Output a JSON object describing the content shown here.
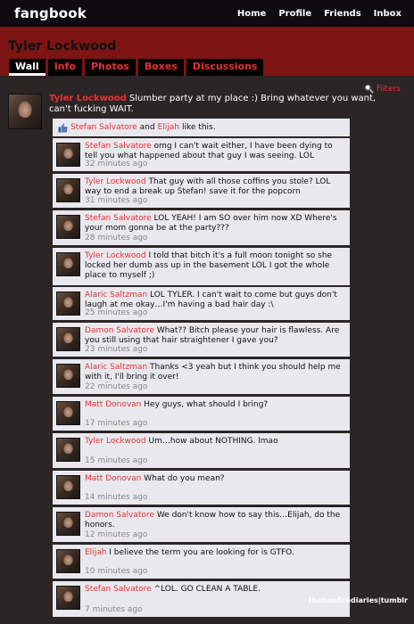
{
  "app": {
    "logo": "fangbook"
  },
  "nav": [
    "Home",
    "Profile",
    "Friends",
    "Inbox"
  ],
  "profile": {
    "name": "Tyler Lockwood"
  },
  "tabs": [
    "Wall",
    "Info",
    "Photos",
    "Boxes",
    "Discussions"
  ],
  "filters": "Filters",
  "post": {
    "author": "Tyler Lockwood",
    "text": "Slumber party at my place :) Bring whatever you want, can't fucking WAIT."
  },
  "likes": {
    "user1": "Stefan Salvatore",
    "and": "and",
    "user2": "Elijah",
    "suffix": "like this."
  },
  "comments": [
    {
      "author": "Stefan Salvatore",
      "text": "omg I can't wait either, I have been dying to tell you what happened about that guy I was seeing. LOL",
      "time": "32 minutes ago"
    },
    {
      "author": "Tyler Lockwood",
      "text": "That guy with all those coffins you stole? LOL way to end a break up Stefan! save it for the popcorn",
      "time": "31 minutes ago"
    },
    {
      "author": "Stefan Salvatore",
      "text": "LOL YEAH! I am SO over him now XD Where's your mom gonna be at the party???",
      "time": "28 minutes ago"
    },
    {
      "author": "Tyler Lockwood",
      "text": "I told that bitch it's a full moon tonight so she locked her dumb ass up in the basement LOL I got the whole place to myself ;)",
      "time": ""
    },
    {
      "author": "Alaric Saltzman",
      "text": "LOL TYLER. I can't wait to come but guys don't laugh at me okay…I'm having a bad hair day :\\",
      "time": "25 minutes ago"
    },
    {
      "author": "Damon Salvatore",
      "text": "What?? Bitch please your hair is flawless. Are you still using that hair straightener I gave you?",
      "time": "23 minutes ago"
    },
    {
      "author": "Alaric Saltzman",
      "text": "Thanks <3 yeah but I think you should help me with it, I'll bring it over!",
      "time": "22 minutes ago"
    },
    {
      "author": "Matt Donovan",
      "text": "Hey guys, what should I bring?",
      "time": "17 minutes ago"
    },
    {
      "author": "Tyler Lockwood",
      "text": "Um…how about NOTHING. lmao",
      "time": "15 minutes ago"
    },
    {
      "author": "Matt Donovan",
      "text": "What do you mean?",
      "time": "14 minutes ago"
    },
    {
      "author": "Damon Salvatore",
      "text": "We don't know how to say this…Elijah, do the honors.",
      "time": "12 minutes ago"
    },
    {
      "author": "Elijah",
      "text": "I believe the term you are looking for is GTFO.",
      "time": "10 minutes ago"
    },
    {
      "author": "Stefan Salvatore",
      "text": "^LOL. GO CLEAN A TABLE.",
      "time": "7 minutes ago"
    }
  ],
  "watermark": "thebonfirediaries|tumblr"
}
